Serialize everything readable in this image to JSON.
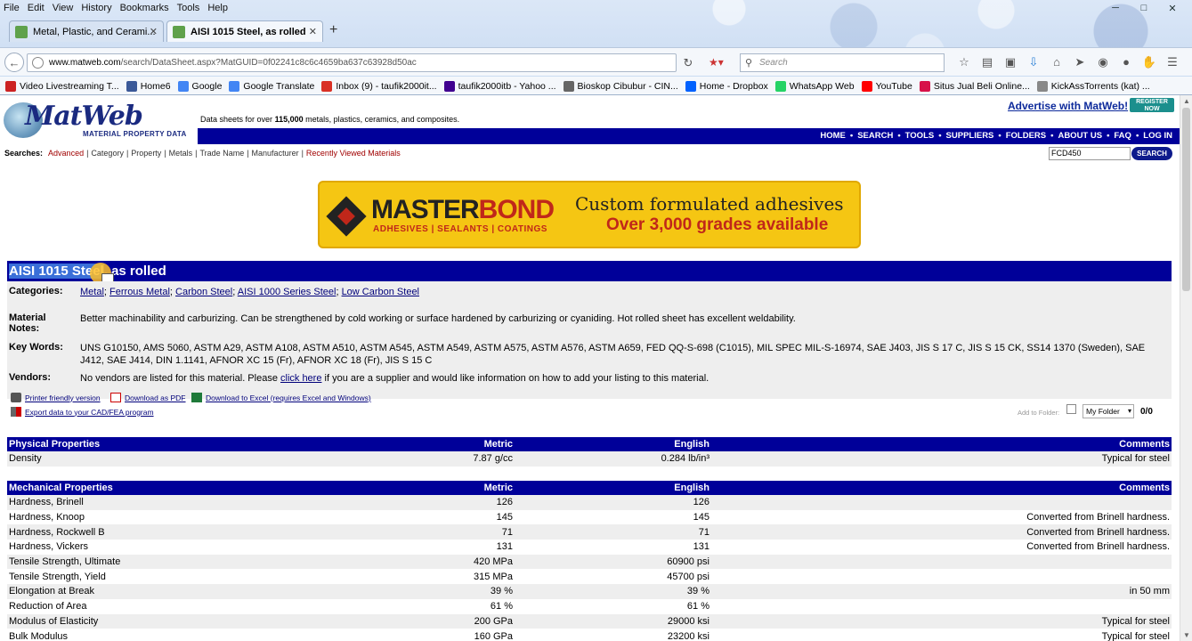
{
  "browser": {
    "menu": [
      "File",
      "Edit",
      "View",
      "History",
      "Bookmarks",
      "Tools",
      "Help"
    ],
    "tabs": [
      {
        "label": "Metal, Plastic, and Cerami..."
      },
      {
        "label": "AISI 1015 Steel, as rolled"
      }
    ],
    "url_host": "www.matweb.com",
    "url_path": "/search/DataSheet.aspx?MatGUID=0f02241c8c6c4659ba637c63928d50ac",
    "search_placeholder": "Search",
    "bookmarks": [
      {
        "label": "Video Livestreaming T...",
        "icon": "livestream-icon",
        "color": "#cc2222"
      },
      {
        "label": "Home6",
        "icon": "facebook-icon",
        "color": "#3b5998"
      },
      {
        "label": "Google",
        "icon": "google-icon",
        "color": "#4285f4"
      },
      {
        "label": "Google Translate",
        "icon": "translate-icon",
        "color": "#4285f4"
      },
      {
        "label": "Inbox (9) - taufik2000it...",
        "icon": "gmail-icon",
        "color": "#d93025"
      },
      {
        "label": "taufik2000itb - Yahoo ...",
        "icon": "mail-icon",
        "color": "#400090"
      },
      {
        "label": "Bioskop Cibubur - CIN...",
        "icon": "cinema-icon",
        "color": "#666666"
      },
      {
        "label": "Home - Dropbox",
        "icon": "dropbox-icon",
        "color": "#0061fe"
      },
      {
        "label": "WhatsApp Web",
        "icon": "whatsapp-icon",
        "color": "#25d366"
      },
      {
        "label": "YouTube",
        "icon": "youtube-icon",
        "color": "#ff0000"
      },
      {
        "label": "Situs Jual Beli Online...",
        "icon": "shop-icon",
        "color": "#d71149"
      },
      {
        "label": "KickAssTorrents (kat) ...",
        "icon": "torrent-icon",
        "color": "#888888"
      }
    ]
  },
  "site": {
    "logo_word": "MatWeb",
    "logo_sub": "MATERIAL PROPERTY DATA",
    "tagline_pre": "Data sheets for over",
    "tagline_count": "115,000",
    "tagline_post": "metals, plastics, ceramics, and composites.",
    "advertise": "Advertise with MatWeb!",
    "register_l1": "REGISTER",
    "register_l2": "NOW",
    "topnav": [
      "HOME",
      "SEARCH",
      "TOOLS",
      "SUPPLIERS",
      "FOLDERS",
      "ABOUT US",
      "FAQ",
      "LOG IN"
    ],
    "searches_label": "Searches:",
    "searches": [
      "Advanced",
      "Category",
      "Property",
      "Metals",
      "Trade Name",
      "Manufacturer",
      "Recently Viewed Materials"
    ],
    "search_value": "FCD450",
    "search_button": "SEARCH"
  },
  "banner": {
    "brand_a": "MASTER",
    "brand_b": "BOND",
    "brand_sub": "ADHESIVES | SEALANTS | COATINGS",
    "line1": "Custom formulated adhesives",
    "line2": "Over 3,000 grades available"
  },
  "material": {
    "title_highlighted": "AISI 1015 Steel",
    "title_rest": ", as rolled",
    "categories_label": "Categories:",
    "categories": [
      "Metal",
      "Ferrous Metal",
      "Carbon Steel",
      "AISI 1000 Series Steel",
      "Low Carbon Steel"
    ],
    "notes_label_1": "Material",
    "notes_label_2": "Notes:",
    "notes": "Better machinability and carburizing. Can be strengthened by cold working or surface hardened by carburizing or cyaniding. Hot rolled sheet has excellent weldability.",
    "keywords_label": "Key Words:",
    "keywords": "UNS G10150, AMS 5060, ASTM A29, ASTM A108, ASTM A510, ASTM A545, ASTM A549, ASTM A575, ASTM A576, ASTM A659, FED QQ-S-698 (C1015), MIL SPEC MIL-S-16974, SAE J403, JIS S 17 C, JIS S 15 CK, SS14 1370 (Sweden), SAE J412, SAE J414, DIN 1.1141, AFNOR XC 15 (Fr), AFNOR XC 18 (Fr), JIS S 15 C",
    "vendors_label": "Vendors:",
    "vendors_pre": "No vendors are listed for this material. Please",
    "vendors_link": "click here",
    "vendors_post": "if you are a supplier and would like information on how to add your listing to this material."
  },
  "tools": {
    "print": "Printer friendly version",
    "pdf": "Download as PDF",
    "excel": "Download to Excel (requires Excel and Windows)",
    "export": "Export data to your CAD/FEA program",
    "add_folder": "Add to Folder:",
    "folder_value": "My Folder",
    "folder_count": "0/0"
  },
  "physical": {
    "header": [
      "Physical Properties",
      "Metric",
      "English",
      "Comments"
    ],
    "rows": [
      [
        "Density",
        "7.87 g/cc",
        "0.284 lb/in³",
        "Typical for steel"
      ]
    ]
  },
  "mechanical": {
    "header": [
      "Mechanical Properties",
      "Metric",
      "English",
      "Comments"
    ],
    "rows": [
      [
        "Hardness, Brinell",
        "126",
        "126",
        ""
      ],
      [
        "Hardness, Knoop",
        "145",
        "145",
        "Converted from Brinell hardness."
      ],
      [
        "Hardness, Rockwell B",
        "71",
        "71",
        "Converted from Brinell hardness."
      ],
      [
        "Hardness, Vickers",
        "131",
        "131",
        "Converted from Brinell hardness."
      ],
      [
        "Tensile Strength, Ultimate",
        "420 MPa",
        "60900 psi",
        ""
      ],
      [
        "Tensile Strength, Yield",
        "315 MPa",
        "45700 psi",
        ""
      ],
      [
        "Elongation at Break",
        "39 %",
        "39 %",
        "in 50 mm"
      ],
      [
        "Reduction of Area",
        "61 %",
        "61 %",
        ""
      ],
      [
        "Modulus of Elasticity",
        "200 GPa",
        "29000 ksi",
        "Typical for steel"
      ],
      [
        "Bulk Modulus",
        "160 GPa",
        "23200 ksi",
        "Typical for steel"
      ]
    ]
  }
}
